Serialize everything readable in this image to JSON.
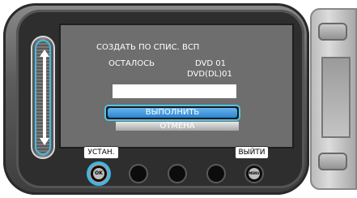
{
  "screen": {
    "title": "СОЗДАТЬ ПО СПИС. ВСП",
    "remaining_label": "ОСТАЛОСЬ",
    "dvd_row": "DVD   01",
    "dvd_dl_row": "DVD(DL)01",
    "field_value": "",
    "execute_label": "ВЫПОЛНИТЬ",
    "cancel_label": "ОТМЕНА",
    "set_label": "УСТАН.",
    "exit_label": "ВЫЙТИ"
  },
  "buttons": {
    "ok_glyph": "OK",
    "menu_glyph": "MENU"
  },
  "colors": {
    "highlight": "#3ab9e8",
    "button_blue": "#2f84cf"
  }
}
